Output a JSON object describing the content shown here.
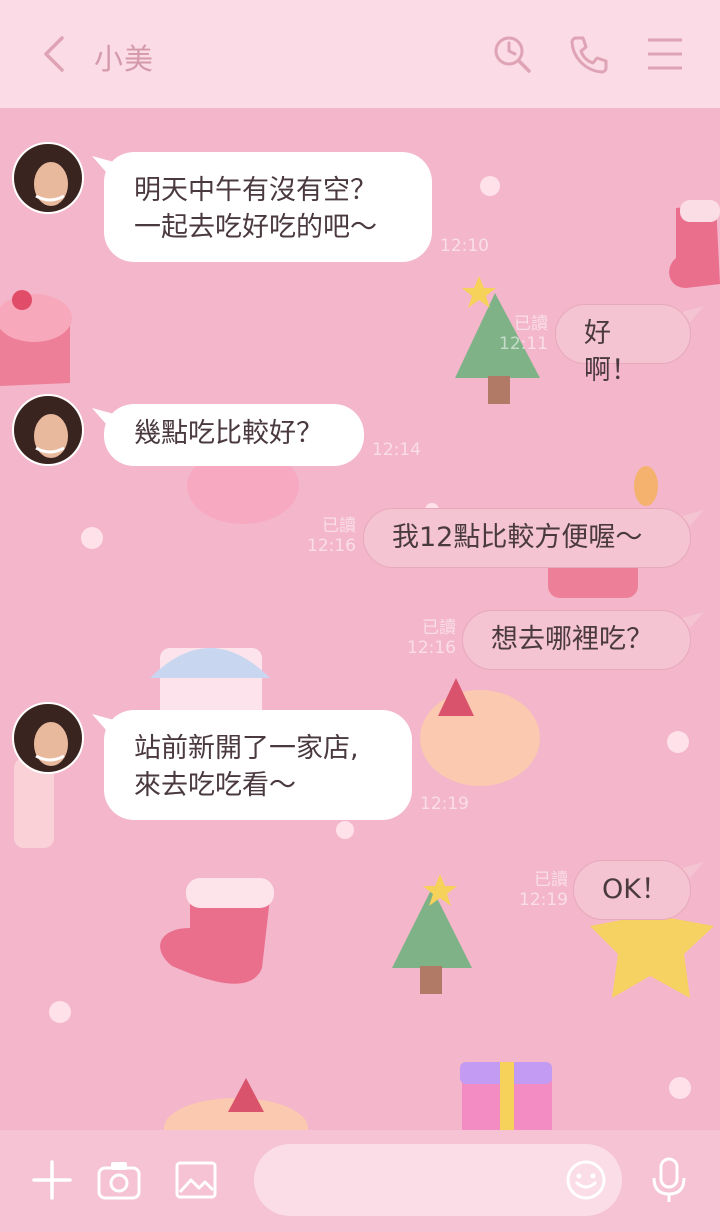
{
  "header": {
    "title": "小美",
    "icons": [
      "back-chevron-icon",
      "search-history-icon",
      "phone-icon",
      "menu-icon"
    ]
  },
  "messages": [
    {
      "side": "in",
      "lines": [
        "明天中午有沒有空？",
        "一起去吃好吃的吧～"
      ],
      "time": "12:10"
    },
    {
      "side": "out",
      "text": "好啊！",
      "read": "已讀",
      "time": "12:11"
    },
    {
      "side": "in",
      "lines": [
        "幾點吃比較好？"
      ],
      "time": "12:14"
    },
    {
      "side": "out",
      "text": "我12點比較方便喔～",
      "read": "已讀",
      "time": "12:16"
    },
    {
      "side": "out",
      "text": "想去哪裡吃？",
      "read": "已讀",
      "time": "12:16"
    },
    {
      "side": "in",
      "lines": [
        "站前新開了一家店,",
        "來去吃吃看～"
      ],
      "time": "12:19"
    },
    {
      "side": "out",
      "text": "OK！",
      "read": "已讀",
      "time": "12:19"
    }
  ],
  "footer": {
    "icons": [
      "plus-icon",
      "camera-icon",
      "image-icon",
      "emoji-icon",
      "microphone-icon"
    ],
    "input_placeholder": ""
  },
  "colors": {
    "header_bg": "#fbdbe5",
    "chat_bg": "#f3b6cb",
    "footer_bg": "#f5c3d3",
    "outgoing_bubble": "#f4c4d2",
    "incoming_bubble": "#ffffff",
    "text": "#4a3a3f",
    "header_icon": "#dfa3b6"
  }
}
